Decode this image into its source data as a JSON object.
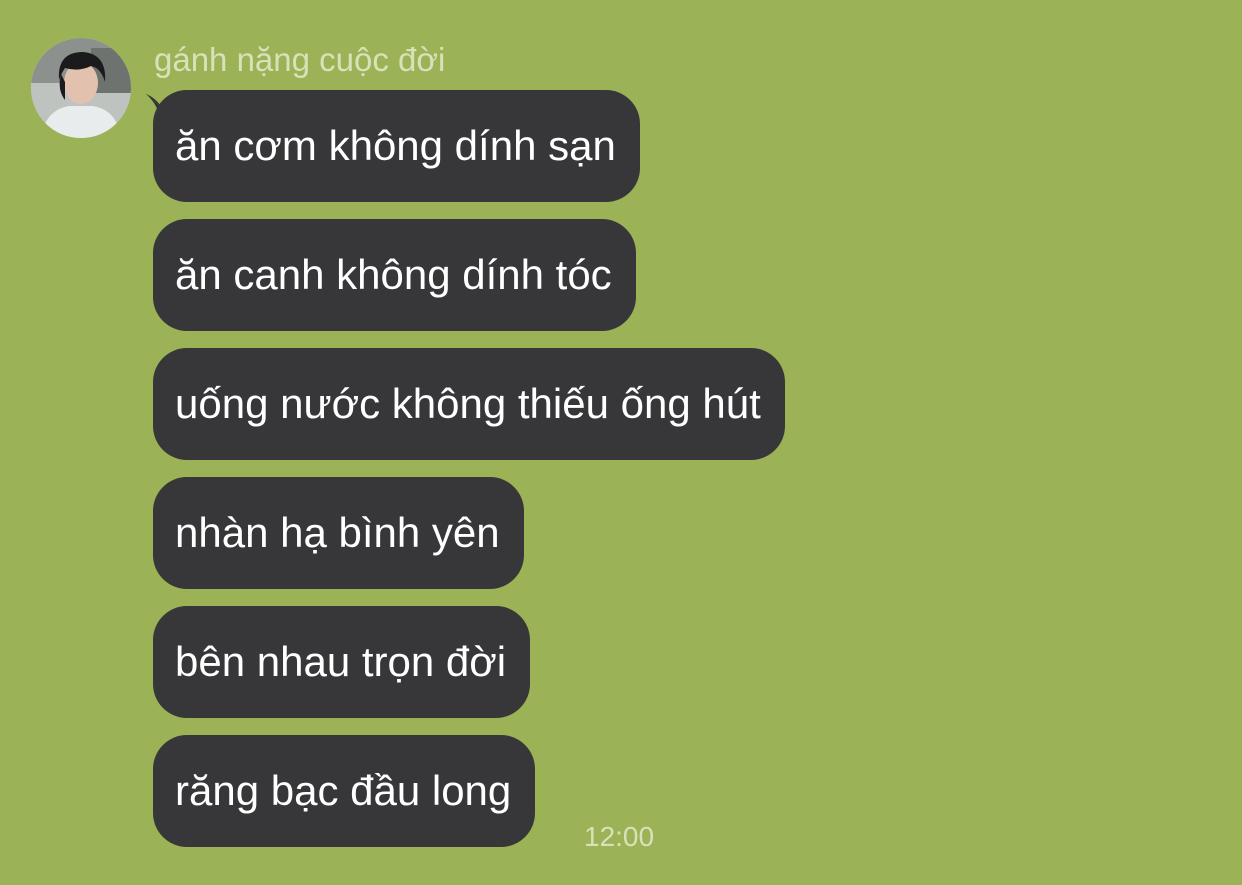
{
  "chat": {
    "sender_name": "gánh nặng cuộc đời",
    "avatar_icon": "user-avatar-photo",
    "messages": [
      {
        "text": "ăn cơm không dính sạn"
      },
      {
        "text": "ăn canh không dính tóc"
      },
      {
        "text": "uống nước không thiếu ống hút"
      },
      {
        "text": "nhàn hạ bình yên"
      },
      {
        "text": "bên nhau trọn đời"
      },
      {
        "text": "răng bạc đầu long"
      }
    ],
    "timestamp": "12:00"
  },
  "colors": {
    "background": "#9bb257",
    "bubble": "#37373a",
    "bubble_text": "#ffffff",
    "meta_text": "#d6e2b8"
  }
}
